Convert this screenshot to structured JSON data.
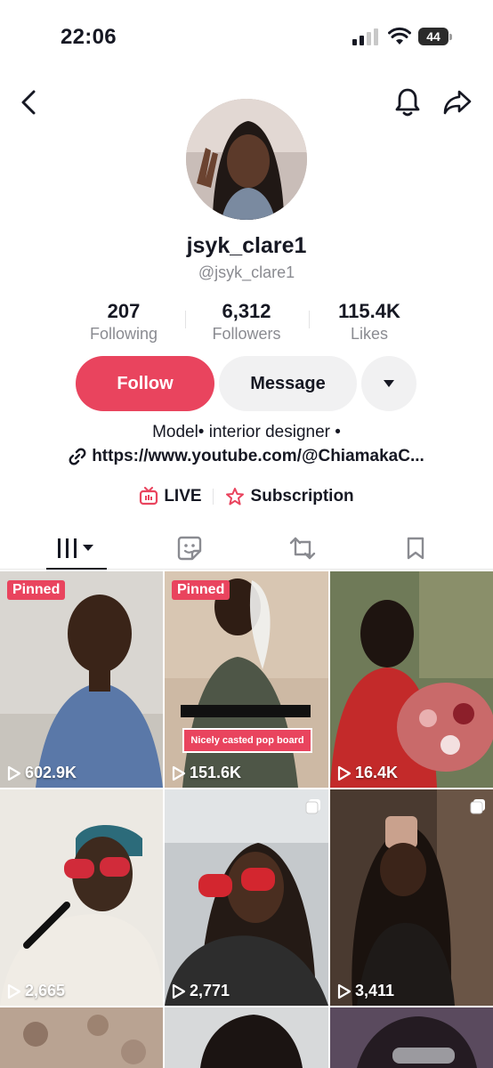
{
  "status": {
    "time": "22:06",
    "battery": "44"
  },
  "profile": {
    "username": "jsyk_clare1",
    "handle": "@jsyk_clare1",
    "stats": {
      "following_value": "207",
      "following_label": "Following",
      "followers_value": "6,312",
      "followers_label": "Followers",
      "likes_value": "115.4K",
      "likes_label": "Likes"
    },
    "bio": "Model• interior designer •",
    "link": "https://www.youtube.com/@ChiamakaC..."
  },
  "actions": {
    "follow_label": "Follow",
    "message_label": "Message"
  },
  "extras": {
    "live_label": "LIVE",
    "subscription_label": "Subscription"
  },
  "videos": [
    {
      "badge": "Pinned",
      "views": "602.9K"
    },
    {
      "badge": "Pinned",
      "views": "151.6K",
      "caption": "Nicely casted pop board"
    },
    {
      "views": "16.4K"
    },
    {
      "views": "2,665"
    },
    {
      "views": "2,771"
    },
    {
      "views": "3,411"
    }
  ],
  "colors": {
    "accent": "#e9445e",
    "text": "#161823",
    "muted": "#8a8b91"
  }
}
